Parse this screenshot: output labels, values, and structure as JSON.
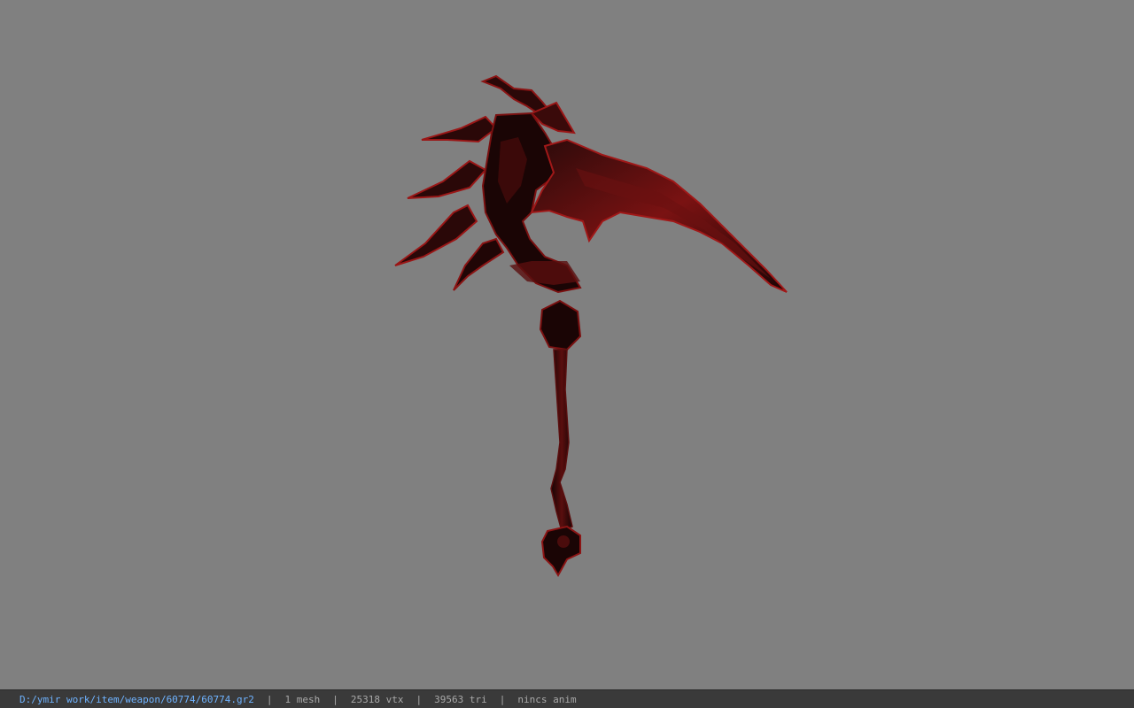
{
  "viewport": {
    "background_color": "#808080",
    "model": {
      "icon": "scythe-weapon-model",
      "base_color": "#1a0808",
      "accent_color": "#8b1414"
    }
  },
  "statusbar": {
    "file_path": "D:/ymir work/item/weapon/60774/60774.gr2",
    "separator": "|",
    "mesh_count": "1 mesh",
    "vertex_count": "25318 vtx",
    "triangle_count": "39563 tri",
    "animation": "nincs anim",
    "path_color": "#6fb3ff",
    "text_color": "#a9a9a9",
    "background_color": "#3a3a3a"
  }
}
